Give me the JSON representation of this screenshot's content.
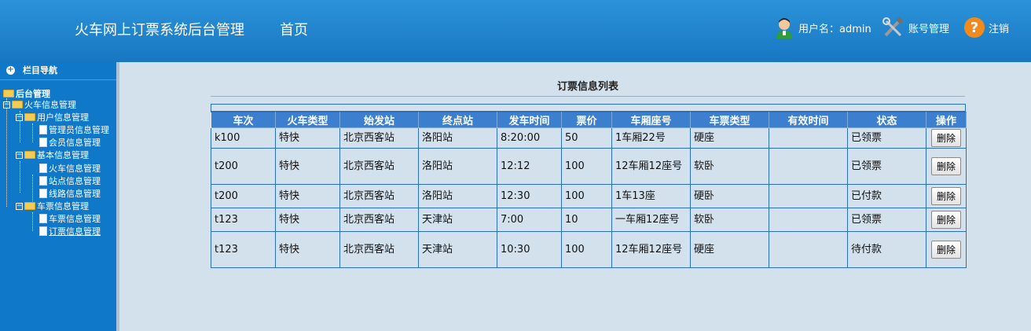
{
  "header": {
    "app_title": "火车网上订票系统后台管理",
    "home": "首页",
    "user_label": "用户名：admin",
    "account": "账号管理",
    "logout": "注销"
  },
  "sidebar": {
    "heading": "栏目导航",
    "root": "后台管理",
    "group1": "火车信息管理",
    "sub_user": "用户信息管理",
    "item_admin": "管理员信息管理",
    "item_member": "会员信息管理",
    "sub_basic": "基本信息管理",
    "item_train": "火车信息管理",
    "item_station": "站点信息管理",
    "item_route": "线路信息管理",
    "sub_ticket": "车票信息管理",
    "item_ticket": "车票信息管理",
    "item_order": "订票信息管理"
  },
  "main": {
    "title": "订票信息列表",
    "columns": [
      "车次",
      "火车类型",
      "始发站",
      "终点站",
      "发车时间",
      "票价",
      "车厢座号",
      "车票类型",
      "有效时间",
      "状态",
      "操作"
    ],
    "delete_label": "删除",
    "rows": [
      [
        "k100",
        "特快",
        "北京西客站",
        "洛阳站",
        "8:20:00",
        "50",
        "1车厢22号",
        "硬座",
        "",
        "已领票"
      ],
      [
        "t200",
        "特快",
        "北京西客站",
        "洛阳站",
        "12:12",
        "100",
        "12车厢12座号",
        "软卧",
        "",
        "已领票"
      ],
      [
        "t200",
        "特快",
        "北京西客站",
        "洛阳站",
        "12:30",
        "100",
        "1车13座",
        "硬卧",
        "",
        "已付款"
      ],
      [
        "t123",
        "特快",
        "北京西客站",
        "天津站",
        "7:00",
        "10",
        "一车厢12座号",
        "软卧",
        "",
        "已领票"
      ],
      [
        "t123",
        "特快",
        "北京西客站",
        "天津站",
        "10:30",
        "100",
        "12车厢12座号",
        "硬座",
        "",
        "待付款"
      ]
    ]
  },
  "colors": {
    "header": "#1876c2",
    "sidebar": "#0f78c8",
    "table_header": "#3c7fcf",
    "content_bg": "#d3e1ec"
  }
}
